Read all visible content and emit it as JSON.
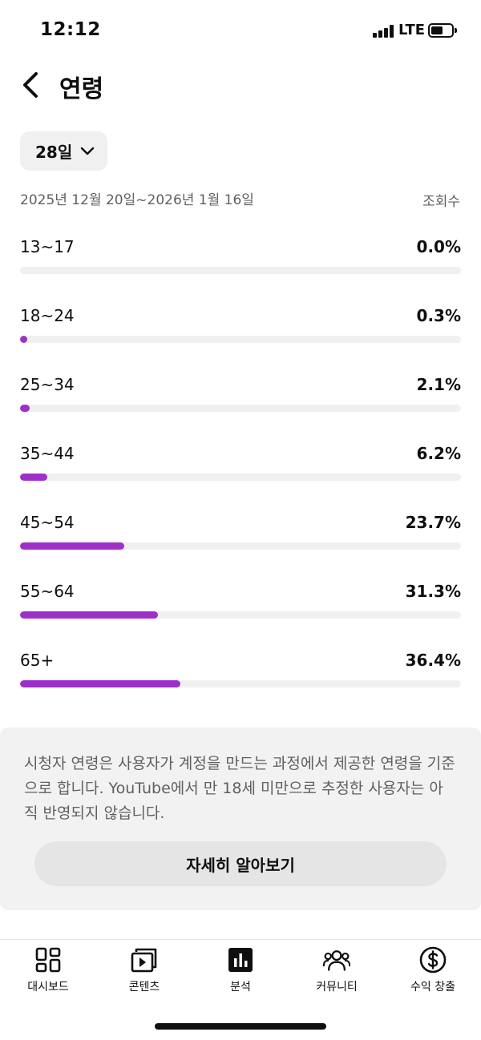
{
  "status_bar": {
    "time": "12:12",
    "network": "LTE",
    "battery_level": 0.55
  },
  "header": {
    "title": "연령"
  },
  "period": {
    "selected": "28일"
  },
  "date_range": "2025년 12월 20일~2026년 1월 16일",
  "metric_label": "조회수",
  "age_groups": [
    {
      "label": "13~17",
      "value": "0.0%",
      "percent": 0.0
    },
    {
      "label": "18~24",
      "value": "0.3%",
      "percent": 0.3
    },
    {
      "label": "25~34",
      "value": "2.1%",
      "percent": 2.1
    },
    {
      "label": "35~44",
      "value": "6.2%",
      "percent": 6.2
    },
    {
      "label": "45~54",
      "value": "23.7%",
      "percent": 23.7
    },
    {
      "label": "55~64",
      "value": "31.3%",
      "percent": 31.3
    },
    {
      "label": "65+",
      "value": "36.4%",
      "percent": 36.4
    }
  ],
  "info": {
    "text": "시청자 연령은 사용자가 계정을 만드는 과정에서 제공한 연령을 기준으로 합니다. YouTube에서 만 18세 미만으로 추정한 사용자는 아직 반영되지 않습니다.",
    "button_label": "자세히 알아보기"
  },
  "bottom_nav": [
    {
      "label": "대시보드",
      "icon": "dashboard-icon",
      "active": false
    },
    {
      "label": "콘텐츠",
      "icon": "content-icon",
      "active": false
    },
    {
      "label": "분석",
      "icon": "analytics-icon",
      "active": true
    },
    {
      "label": "커뮤니티",
      "icon": "community-icon",
      "active": false
    },
    {
      "label": "수익 창출",
      "icon": "earn-icon",
      "active": false
    }
  ],
  "colors": {
    "accent": "#9c30c8",
    "track": "#f0f0f0",
    "secondary_text": "#606060"
  }
}
